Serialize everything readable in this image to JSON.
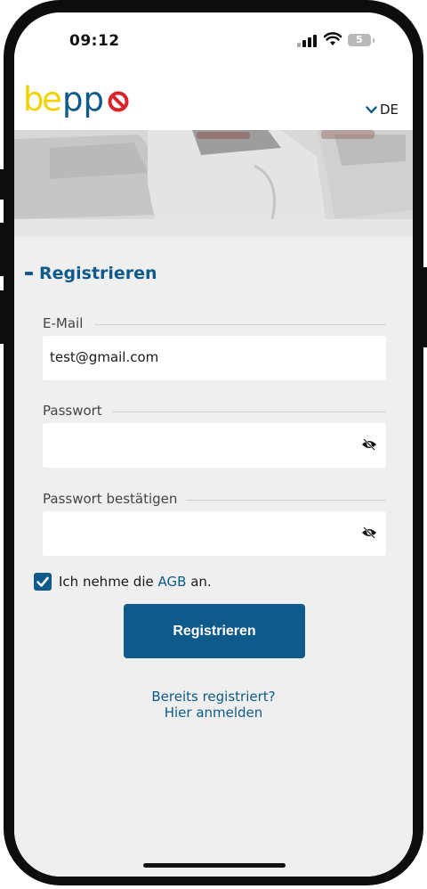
{
  "status_bar": {
    "time": "09:12",
    "battery": "5"
  },
  "header": {
    "logo": "beppo",
    "language": "DE"
  },
  "register": {
    "title": "Registrieren",
    "email_label": "E-Mail",
    "email_value": "test@gmail.com",
    "password_label": "Passwort",
    "password_value": "",
    "confirm_label": "Passwort bestätigen",
    "confirm_value": "",
    "terms_prefix": "Ich nehme die",
    "terms_link": "AGB",
    "terms_suffix": "an.",
    "terms_checked": true,
    "submit_label": "Registrieren",
    "login_line1": "Bereits registriert?",
    "login_line2": "Hier anmelden"
  },
  "colors": {
    "accent": "#0e5a8a",
    "background": "#efefef",
    "logo_yellow": "#f2d300",
    "logo_red": "#d6252b"
  },
  "icons": [
    "signal-icon",
    "wifi-icon",
    "battery-icon",
    "chevron-down-icon",
    "eye-slash-icon",
    "checkmark-icon"
  ]
}
